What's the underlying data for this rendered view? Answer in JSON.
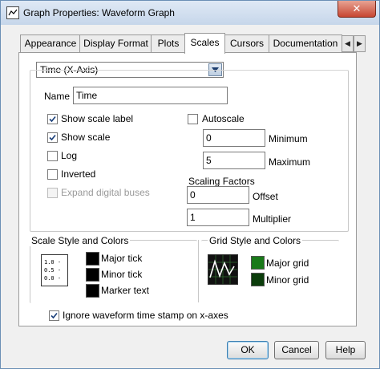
{
  "window": {
    "title": "Graph Properties: Waveform Graph",
    "close_label": "✕"
  },
  "tabs": {
    "items": [
      {
        "label": "Appearance"
      },
      {
        "label": "Display Format"
      },
      {
        "label": "Plots"
      },
      {
        "label": "Scales"
      },
      {
        "label": "Cursors"
      },
      {
        "label": "Documentation"
      }
    ],
    "active": "Scales",
    "scroll_left": "◀",
    "scroll_right": "▶"
  },
  "axis_select": {
    "value": "Time (X-Axis)"
  },
  "name_field": {
    "label": "Name",
    "value": "Time"
  },
  "options": {
    "show_scale_label": {
      "label": "Show scale label",
      "checked": true
    },
    "show_scale": {
      "label": "Show scale",
      "checked": true
    },
    "log": {
      "label": "Log",
      "checked": false
    },
    "inverted": {
      "label": "Inverted",
      "checked": false
    },
    "expand_digital_buses": {
      "label": "Expand digital buses",
      "checked": false,
      "disabled": true
    }
  },
  "autoscale": {
    "label": "Autoscale",
    "checked": false,
    "minimum": {
      "label": "Minimum",
      "value": "0"
    },
    "maximum": {
      "label": "Maximum",
      "value": "5"
    }
  },
  "scaling_factors": {
    "title": "Scaling Factors",
    "offset": {
      "label": "Offset",
      "value": "0"
    },
    "multiplier": {
      "label": "Multiplier",
      "value": "1"
    }
  },
  "scale_style": {
    "title": "Scale Style and Colors",
    "icon_lines": [
      "1.0 -",
      "0.5 -",
      "0.0 -"
    ],
    "major_tick": {
      "label": "Major tick",
      "color": "#000000"
    },
    "minor_tick": {
      "label": "Minor tick",
      "color": "#000000"
    },
    "marker_text": {
      "label": "Marker text",
      "color": "#000000"
    }
  },
  "grid_style": {
    "title": "Grid Style and Colors",
    "major_grid": {
      "label": "Major grid",
      "color": "#1a7a1a"
    },
    "minor_grid": {
      "label": "Minor grid",
      "color": "#0b3d0b"
    }
  },
  "ignore_timestamp": {
    "label": "Ignore waveform time stamp on x-axes",
    "checked": true
  },
  "buttons": {
    "ok": "OK",
    "cancel": "Cancel",
    "help": "Help"
  }
}
